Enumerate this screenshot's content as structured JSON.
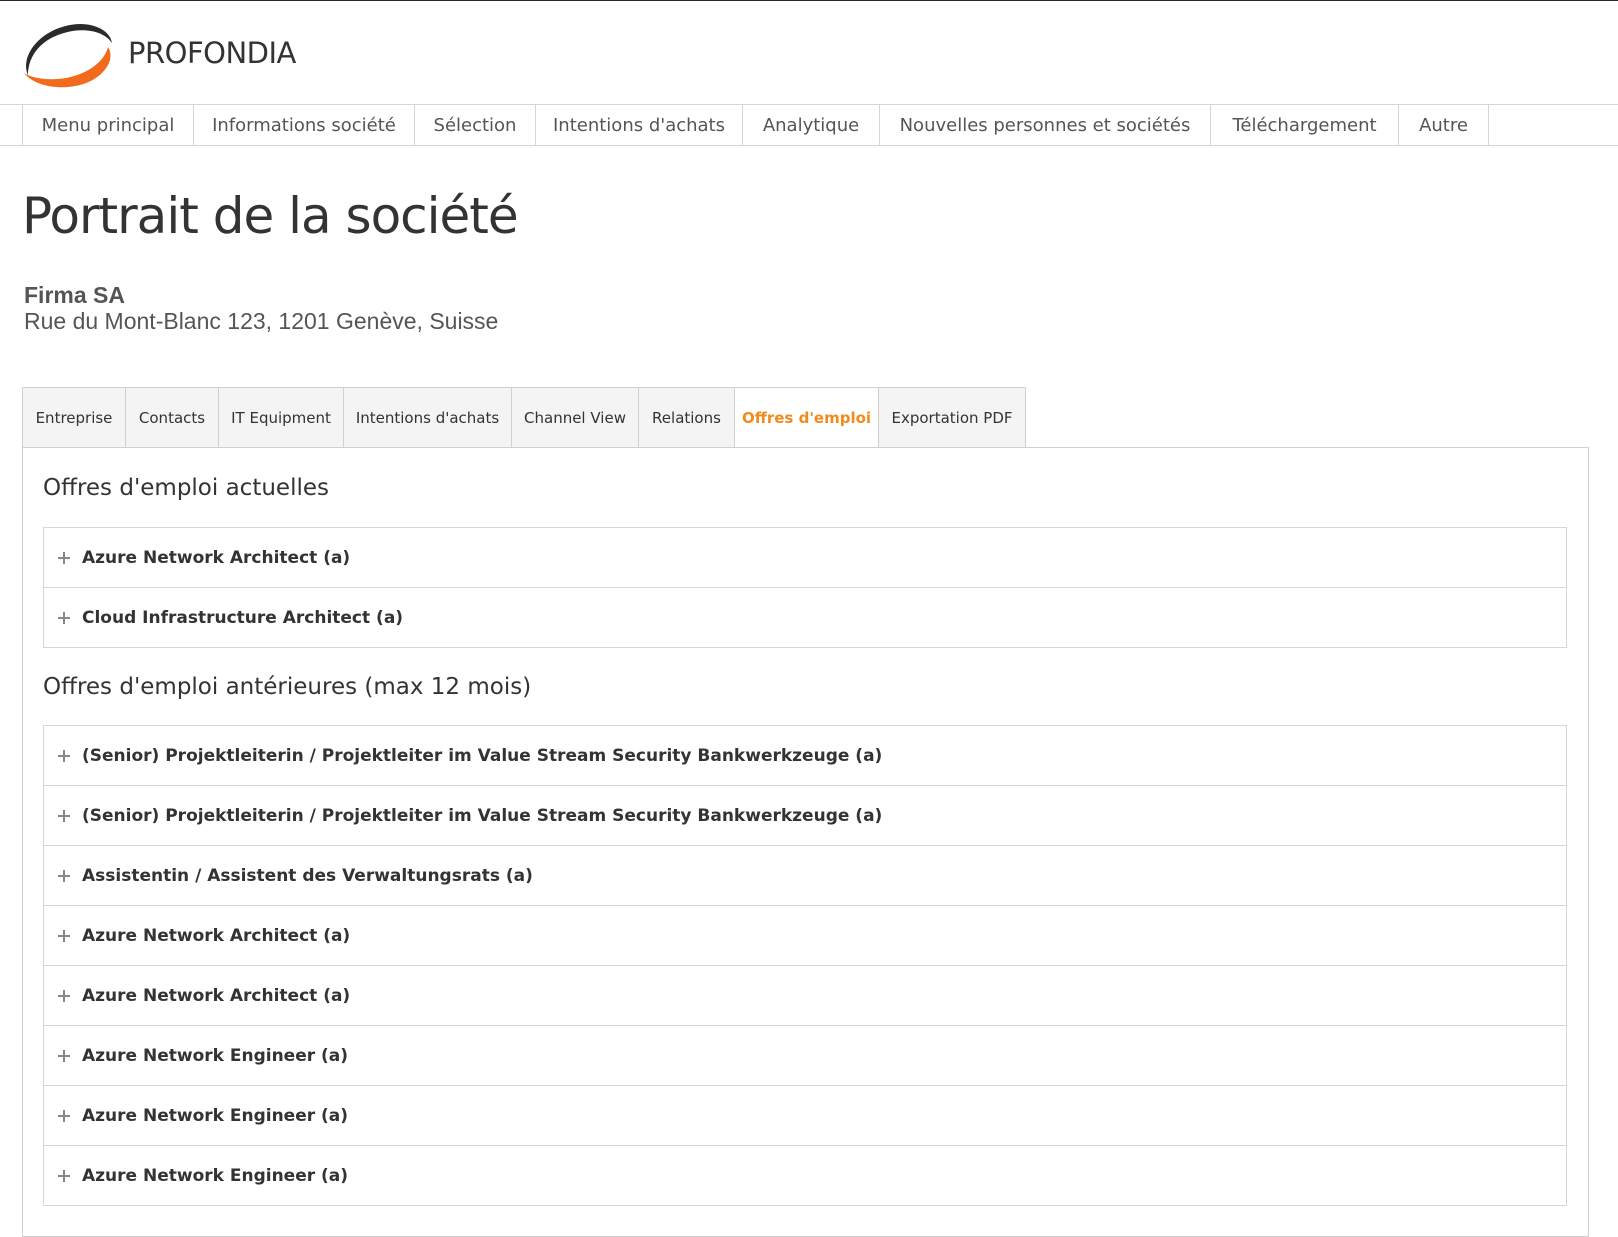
{
  "brand": {
    "name": "PROFONDIA",
    "logo_icon": "swoosh-logo-icon",
    "colors": {
      "accent": "#f28a1e",
      "logo_dark": "#2b2b2b",
      "logo_orange": "#f26a1b"
    }
  },
  "main_nav": {
    "items": [
      {
        "label": "Menu principal"
      },
      {
        "label": "Informations société"
      },
      {
        "label": "Sélection"
      },
      {
        "label": "Intentions d'achats"
      },
      {
        "label": "Analytique"
      },
      {
        "label": "Nouvelles personnes et sociétés"
      },
      {
        "label": "Téléchargement"
      },
      {
        "label": "Autre"
      }
    ]
  },
  "page": {
    "title": "Portrait de la société",
    "company_name": "Firma SA",
    "company_address": "Rue du Mont-Blanc 123, 1201 Genève, Suisse"
  },
  "tabs": {
    "items": [
      {
        "label": "Entreprise"
      },
      {
        "label": "Contacts"
      },
      {
        "label": "IT Equipment"
      },
      {
        "label": "Intentions d'achats"
      },
      {
        "label": "Channel View"
      },
      {
        "label": "Relations"
      },
      {
        "label": "Offres d'emploi"
      },
      {
        "label": "Exportation PDF"
      }
    ],
    "active": "Offres d'emploi"
  },
  "current_jobs": {
    "title": "Offres d'emploi actuelles",
    "items": [
      {
        "label": "Azure Network Architect (a)"
      },
      {
        "label": "Cloud Infrastructure Architect (a)"
      }
    ]
  },
  "previous_jobs": {
    "title": "Offres d'emploi antérieures (max 12 mois)",
    "items": [
      {
        "label": "(Senior) Projektleiterin / Projektleiter im Value Stream Security Bankwerkzeuge (a)"
      },
      {
        "label": "(Senior) Projektleiterin / Projektleiter im Value Stream Security Bankwerkzeuge (a)"
      },
      {
        "label": "Assistentin / Assistent des Verwaltungsrats (a)"
      },
      {
        "label": "Azure Network Architect (a)"
      },
      {
        "label": "Azure Network Architect (a)"
      },
      {
        "label": "Azure Network Engineer (a)"
      },
      {
        "label": "Azure Network Engineer (a)"
      },
      {
        "label": "Azure Network Engineer (a)"
      }
    ]
  }
}
